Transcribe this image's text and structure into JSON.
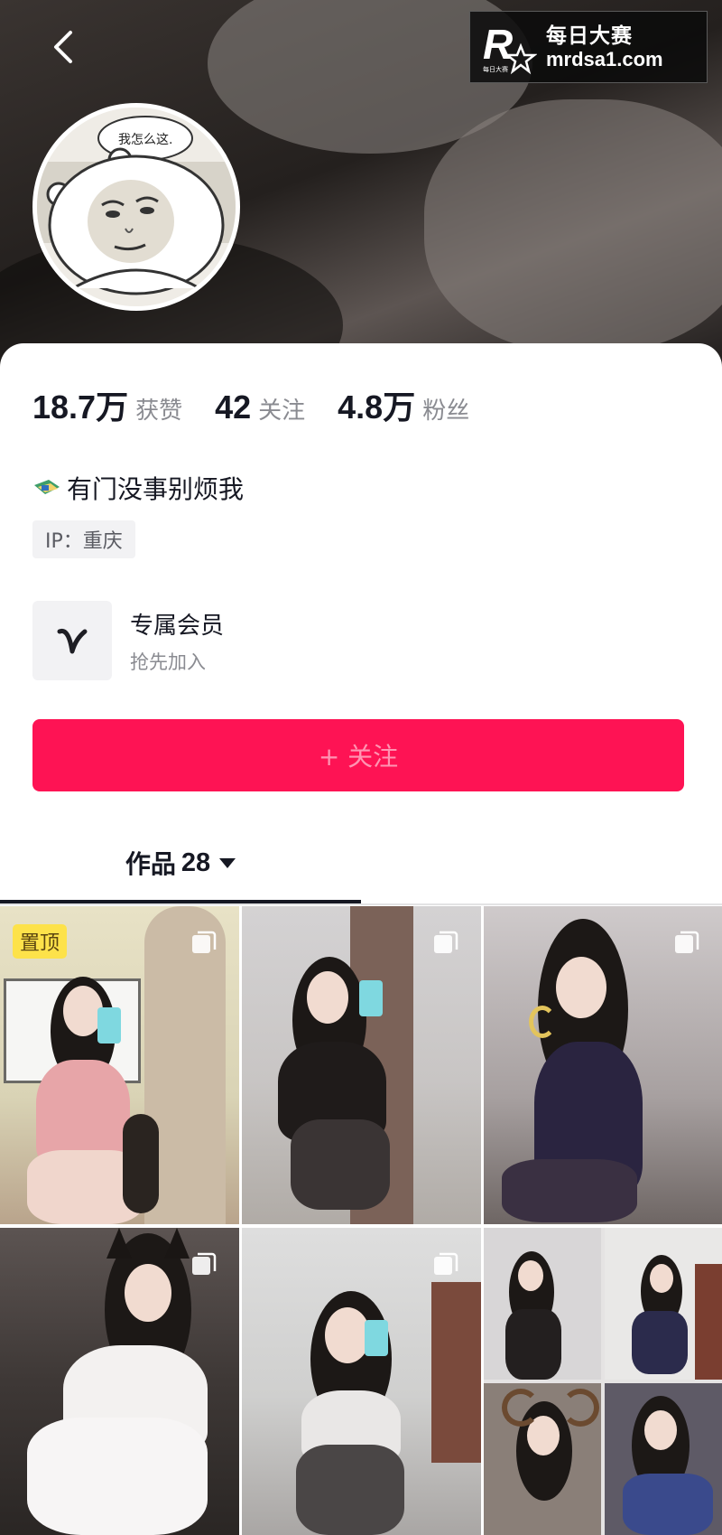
{
  "header": {
    "back_icon": "chevron-left-icon",
    "watermark": {
      "title": "每日大赛",
      "url": "mrdsa1.com",
      "logo_letter": "R",
      "logo_small": "每日大赛"
    },
    "avatar_speech": "我怎么这."
  },
  "profile": {
    "stats": [
      {
        "value": "18.7万",
        "label": "获赞"
      },
      {
        "value": "42",
        "label": "关注"
      },
      {
        "value": "4.8万",
        "label": "粉丝"
      }
    ],
    "bio": "有门没事别烦我",
    "ip": "IP：重庆",
    "member": {
      "title": "专属会员",
      "subtitle": "抢先加入",
      "icon": "v-logo-icon"
    },
    "follow_button": "+ 关注"
  },
  "tabs": {
    "works_label": "作品",
    "works_count": "28"
  },
  "grid": {
    "pinned_label": "置顶",
    "tiles": [
      "video-1",
      "video-2",
      "video-3",
      "video-4",
      "video-5",
      "video-6"
    ]
  },
  "colors": {
    "accent": "#fe1354",
    "pin": "#fde24a",
    "text": "#161823",
    "muted": "#8a8b91"
  }
}
